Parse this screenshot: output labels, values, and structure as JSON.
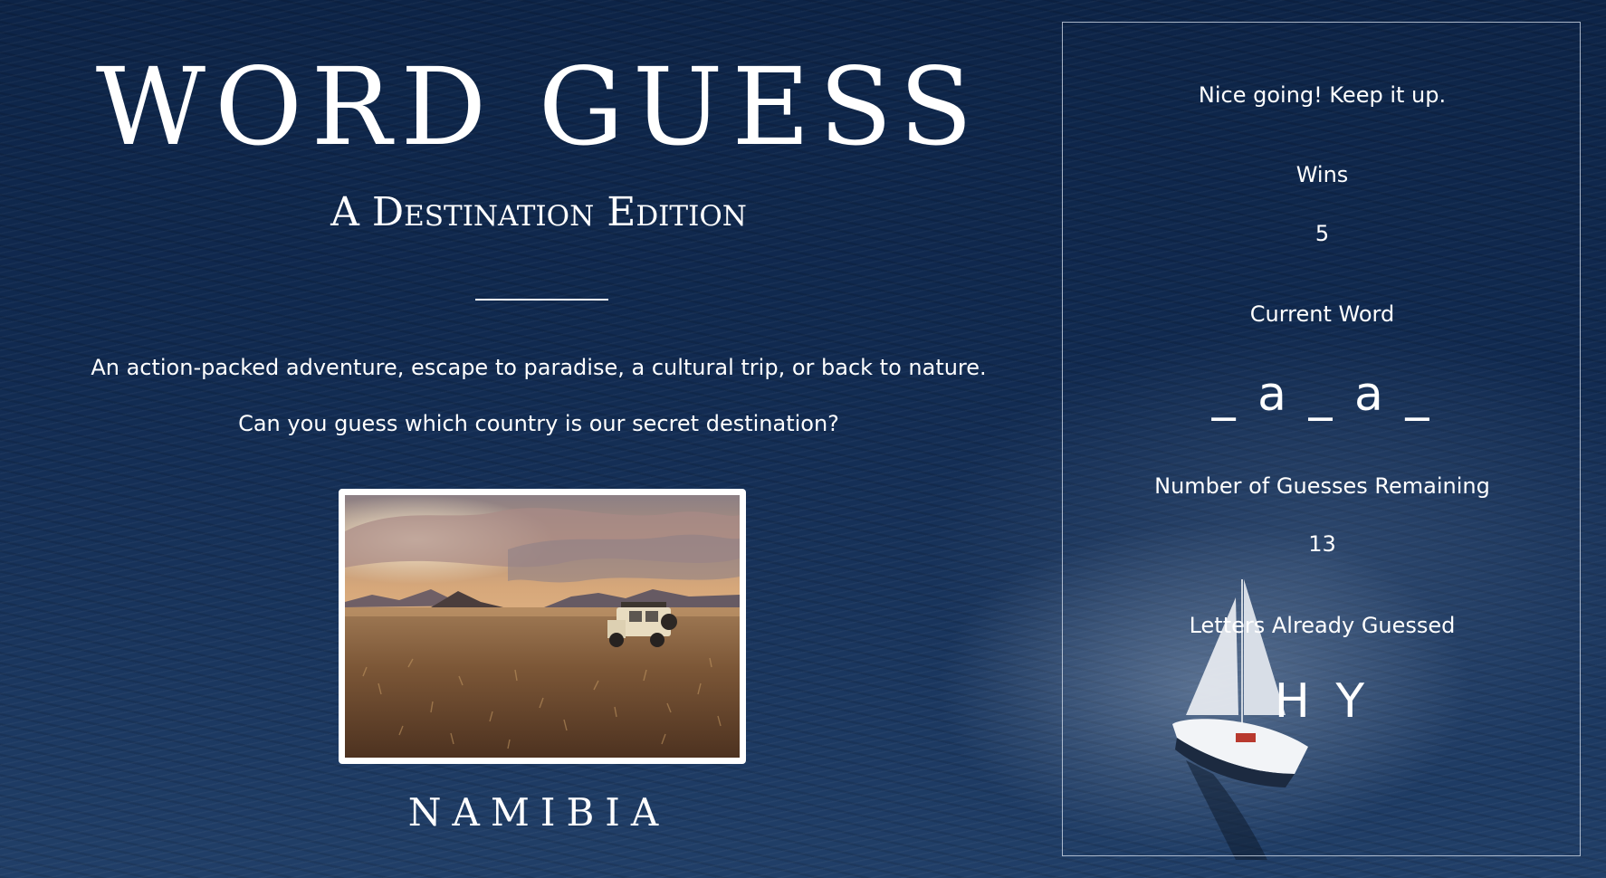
{
  "game": {
    "title": "WORD GUESS",
    "subtitle": "A Destination Edition",
    "intro": "An action-packed adventure, escape to paradise, a cultural trip, or back to nature.",
    "question": "Can you guess which country is our secret destination?",
    "answer_country": "NAMIBIA",
    "photo_icon": "desert-landscape-photo"
  },
  "scoreboard": {
    "status_message": "Nice going! Keep it up.",
    "wins_label": "Wins",
    "wins_value": "5",
    "current_word_label": "Current Word",
    "current_word": "_ a _ a _",
    "guesses_remaining_label": "Number of Guesses Remaining",
    "guesses_remaining": "13",
    "letters_guessed_label": "Letters Already Guessed",
    "letters_guessed": "H Y"
  },
  "background": {
    "scene": "ocean-with-sailboat",
    "ocean_color": "#112a50"
  }
}
